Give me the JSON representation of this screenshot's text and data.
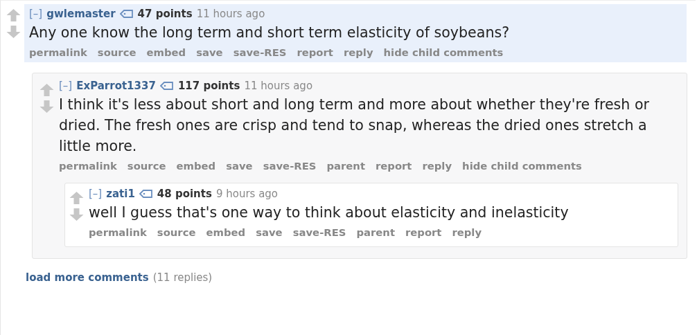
{
  "comments": [
    {
      "collapse": "[–]",
      "author": "gwlemaster",
      "points": "47 points",
      "time": "11 hours ago",
      "highlighted": true,
      "body": "Any one know the long term and short term elasticity of soybeans?",
      "actions": [
        "permalink",
        "source",
        "embed",
        "save",
        "save-RES",
        "report",
        "reply",
        "hide child comments"
      ],
      "children": [
        {
          "collapse": "[–]",
          "author": "ExParrot1337",
          "points": "117 points",
          "time": "11 hours ago",
          "highlighted": false,
          "body": "I think it's less about short and long term and more about whether they're fresh or dried. The fresh ones are crisp and tend to snap, whereas the dried ones stretch a little more.",
          "actions": [
            "permalink",
            "source",
            "embed",
            "save",
            "save-RES",
            "parent",
            "report",
            "reply",
            "hide child comments"
          ],
          "children": [
            {
              "collapse": "[–]",
              "author": "zati1",
              "points": "48 points",
              "time": "9 hours ago",
              "highlighted": false,
              "body": "well I guess that's one way to think about elasticity and inelasticity",
              "actions": [
                "permalink",
                "source",
                "embed",
                "save",
                "save-RES",
                "parent",
                "report",
                "reply"
              ]
            }
          ]
        }
      ]
    }
  ],
  "load_more": {
    "label": "load more comments",
    "count": "(11 replies)"
  }
}
